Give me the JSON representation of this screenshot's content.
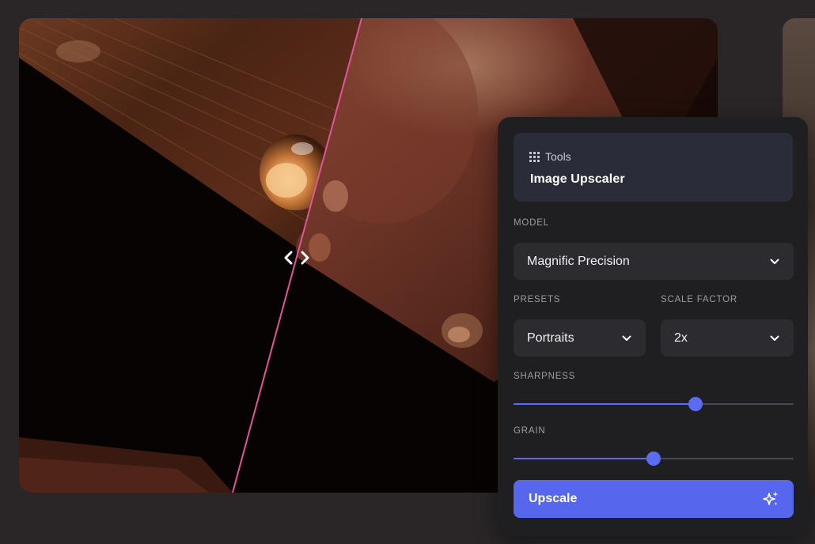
{
  "panel": {
    "breadcrumb": "Tools",
    "title": "Image Upscaler",
    "model": {
      "label": "MODEL",
      "value": "Magnific Precision"
    },
    "presets": {
      "label": "PRESETS",
      "value": "Portraits"
    },
    "scale_factor": {
      "label": "SCALE FACTOR",
      "value": "2x"
    },
    "sharpness": {
      "label": "SHARPNESS",
      "value": 0.65
    },
    "grain": {
      "label": "GRAIN",
      "value": 0.5
    },
    "upscale_label": "Upscale"
  },
  "colors": {
    "accent": "#5667ee",
    "divider_line": "#e0559a",
    "panel_bg": "#1f1f22"
  },
  "icons": {
    "breadcrumb": "grid-icon",
    "chevron": "chevron-down-icon",
    "upscale": "sparkle-icon",
    "compare_handle": "compare-arrows-icon"
  }
}
